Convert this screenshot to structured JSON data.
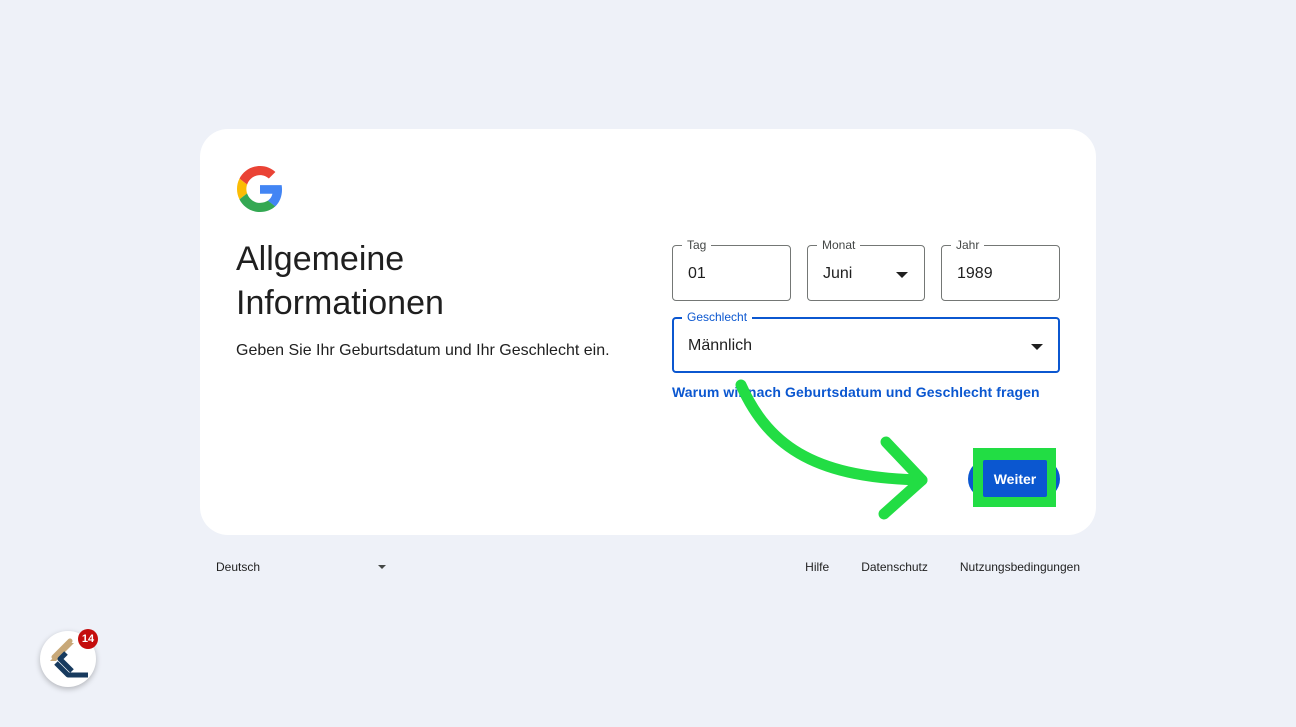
{
  "page": {
    "title": "Allgemeine Informationen",
    "subtitle": "Geben Sie Ihr Geburtsdatum und Ihr Geschlecht ein."
  },
  "fields": {
    "day": {
      "label": "Tag",
      "value": "01"
    },
    "month": {
      "label": "Monat",
      "value": "Juni"
    },
    "year": {
      "label": "Jahr",
      "value": "1989"
    },
    "gender": {
      "label": "Geschlecht",
      "value": "Männlich"
    }
  },
  "why_link": "Warum wir nach Geburtsdatum und Geschlecht fragen",
  "next_button": "Weiter",
  "footer": {
    "language": "Deutsch",
    "links": [
      "Hilfe",
      "Datenschutz",
      "Nutzungsbedingungen"
    ]
  },
  "extension": {
    "icon": "tag-logo-icon",
    "count": "14"
  },
  "colors": {
    "background": "#eef1f8",
    "primary": "#0b57d0",
    "highlight": "#22dd44",
    "badge": "#c40d0d"
  }
}
